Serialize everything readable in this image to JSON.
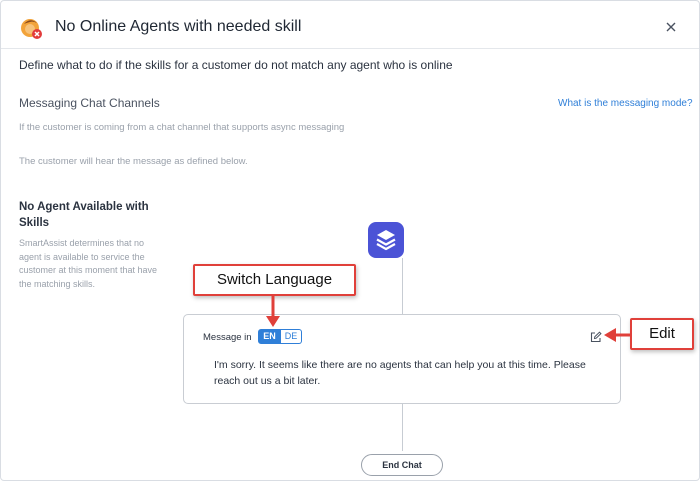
{
  "dialog": {
    "title": "No Online Agents with needed skill",
    "description": "Define what to do if the skills for a customer do not match any agent who is online"
  },
  "messaging": {
    "section_title": "Messaging Chat Channels",
    "mode_link": "What is the messaging mode?",
    "line1": "If the customer is coming from a chat channel that supports async messaging",
    "line2": "The customer will hear the message as defined below."
  },
  "no_agent": {
    "title": "No Agent Available with Skills",
    "description": "SmartAssist determines that no agent is available to service the customer at this moment that have the matching skills."
  },
  "message_card": {
    "label": "Message in",
    "languages": [
      "EN",
      "DE"
    ],
    "selected_language": "EN",
    "text": "I'm sorry. It seems like there are no agents that can help you at this time. Please reach out us a bit later."
  },
  "end_chat_label": "End Chat",
  "annotations": {
    "switch_language": "Switch Language",
    "edit": "Edit"
  },
  "colors": {
    "accent_blue": "#2f7fd8",
    "flow_icon": "#4b53d6",
    "callout_red": "#e0403a"
  },
  "icons": {
    "app": "agent-offline-icon",
    "close": "close-icon",
    "flow": "layers-icon",
    "edit": "edit-icon"
  }
}
